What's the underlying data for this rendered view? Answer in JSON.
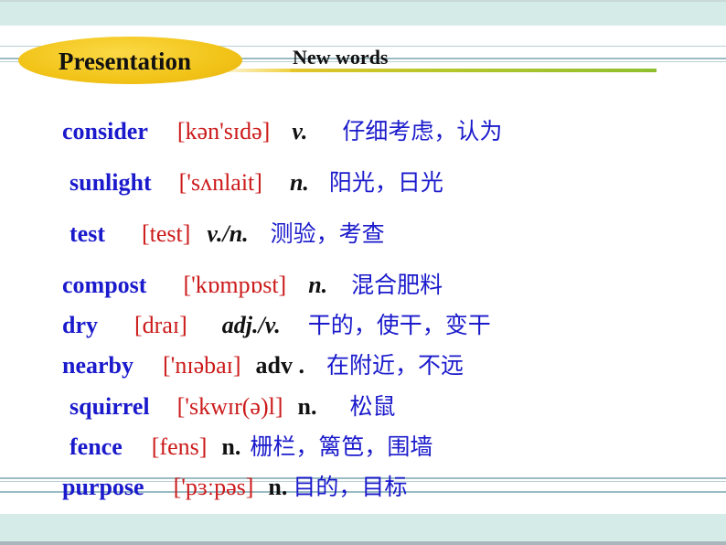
{
  "header": {
    "badge_label": "Presentation",
    "section_title": "New words"
  },
  "colors": {
    "word": "#1a1acc",
    "phonetic": "#cc1a1a",
    "part_of_speech": "#111111",
    "meaning": "#1a1acc",
    "badge": "#f2c419",
    "band": "#d5ebe8"
  },
  "vocabulary": [
    {
      "word": "consider",
      "phonetic": "[kən'sɪdə]",
      "pos": "v.",
      "meaning": "仔细考虑，认为"
    },
    {
      "word": "sunlight",
      "phonetic": "['sʌnlait]",
      "pos": "n.",
      "meaning": "阳光，日光"
    },
    {
      "word": "test",
      "phonetic": "[test]",
      "pos": "v./n.",
      "meaning": "测验，考查"
    },
    {
      "word": "compost",
      "phonetic": "['kɒmpɒst]",
      "pos": "n.",
      "meaning": "混合肥料"
    },
    {
      "word": "dry",
      "phonetic": "[draɪ]",
      "pos": "adj./v.",
      "meaning": "干的，使干，变干"
    },
    {
      "word": "nearby",
      "phonetic": "['nɪəbaɪ]",
      "pos": "adv .",
      "meaning": "在附近，不远"
    },
    {
      "word": "squirrel",
      "phonetic": "['skwɪr(ə)l]",
      "pos": "n.",
      "meaning": "松鼠"
    },
    {
      "word": "fence",
      "phonetic": "[fens]",
      "pos": "n.",
      "meaning": "栅栏，篱笆，围墙"
    },
    {
      "word": "purpose",
      "phonetic": "['pɜːpəs]",
      "pos": "n.",
      "meaning": "目的，目标"
    }
  ]
}
